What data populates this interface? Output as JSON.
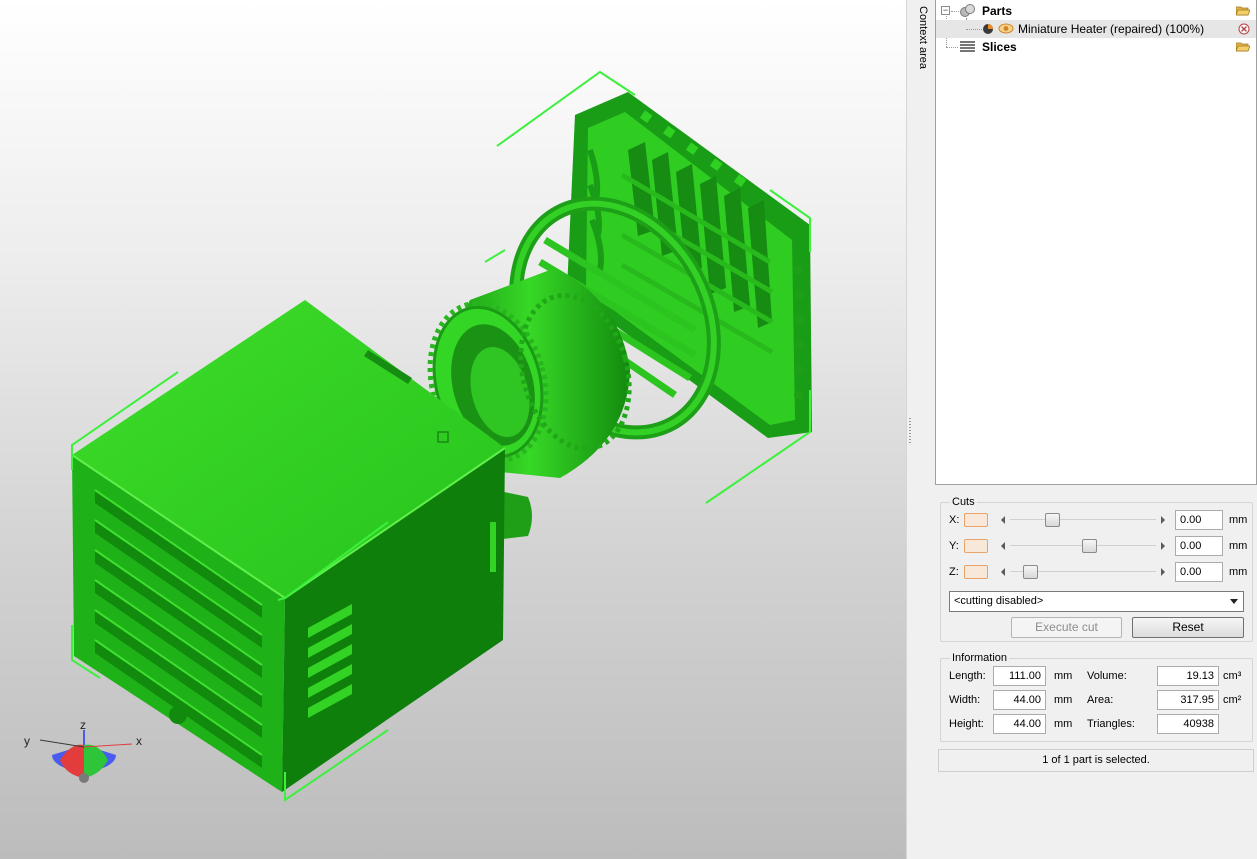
{
  "context_tab": {
    "label": "Context area"
  },
  "tree": {
    "parts_label": "Parts",
    "part_item_label": "Miniature Heater (repaired) (100%)",
    "slices_label": "Slices",
    "expander_symbol": "−"
  },
  "cuts": {
    "title": "Cuts",
    "axes": [
      {
        "label": "X:",
        "value": "0.00",
        "unit": "mm",
        "slider_fraction": 0.27
      },
      {
        "label": "Y:",
        "value": "0.00",
        "unit": "mm",
        "slider_fraction": 0.55
      },
      {
        "label": "Z:",
        "value": "0.00",
        "unit": "mm",
        "slider_fraction": 0.1
      }
    ],
    "mode_selected": "<cutting disabled>",
    "execute_label": "Execute cut",
    "reset_label": "Reset"
  },
  "information": {
    "title": "Information",
    "length_label": "Length:",
    "length_value": "111.00",
    "length_unit": "mm",
    "width_label": "Width:",
    "width_value": "44.00",
    "width_unit": "mm",
    "height_label": "Height:",
    "height_value": "44.00",
    "height_unit": "mm",
    "volume_label": "Volume:",
    "volume_value": "19.13",
    "volume_unit": "cm³",
    "area_label": "Area:",
    "area_value": "317.95",
    "area_unit": "cm²",
    "triangles_label": "Triangles:",
    "triangles_value": "40938"
  },
  "status": {
    "text": "1 of 1 part is selected."
  },
  "axis_gizmo": {
    "x_label": "x",
    "y_label": "y",
    "z_label": "z"
  },
  "colors": {
    "model_green": "#22c322",
    "bbox_green": "#3cf03c",
    "selection_orange": "#e8a46b"
  }
}
